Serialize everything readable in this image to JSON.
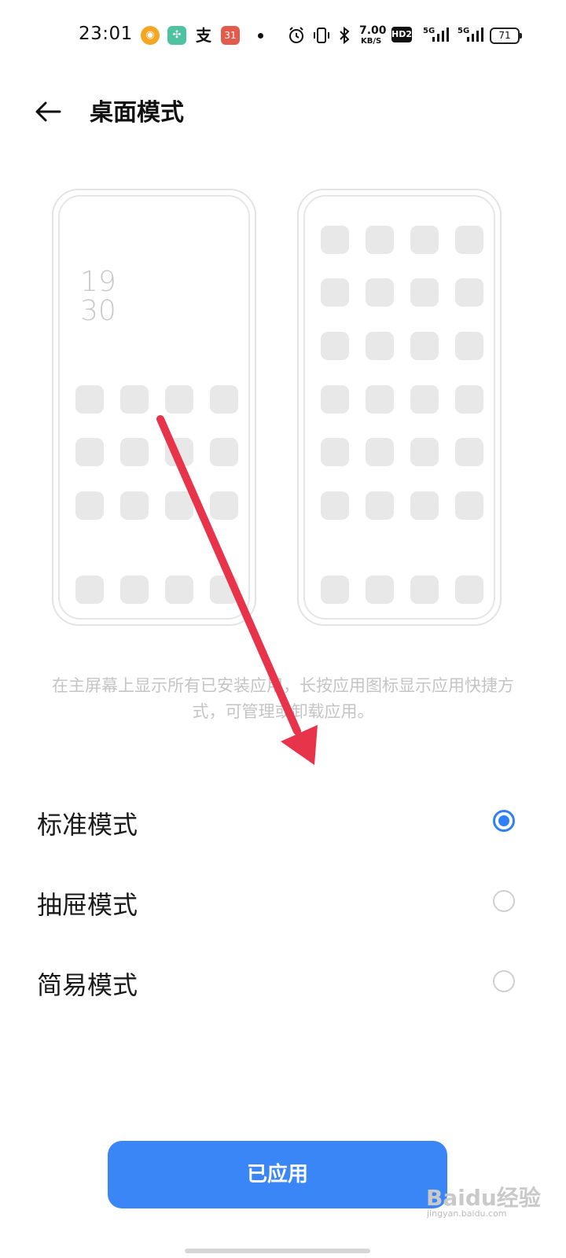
{
  "status_bar": {
    "time": "23:01",
    "calendar_badge": "31",
    "network_speed_value": "7.00",
    "network_speed_unit": "KB/S",
    "hd_label": "HD2",
    "sim1_label": "5G",
    "sim2_label": "5G",
    "battery": "71",
    "icons": [
      "weibo-icon",
      "wechat-mini-icon",
      "alipay-icon",
      "calendar-icon",
      "dot-icon",
      "alarm-icon",
      "vibrate-icon",
      "bluetooth-icon",
      "hd-icon",
      "signal-icon",
      "battery-icon"
    ]
  },
  "header": {
    "back_icon": "arrow-left-icon",
    "title": "桌面模式"
  },
  "preview": {
    "clock_hour": "19",
    "clock_minute": "30"
  },
  "description": "在主屏幕上显示所有已安装应用，长按应用图标显示应用快捷方式，可管理或卸载应用。",
  "options": [
    {
      "label": "标准模式",
      "selected": true
    },
    {
      "label": "抽屉模式",
      "selected": false
    },
    {
      "label": "简易模式",
      "selected": false
    }
  ],
  "apply_button": "已应用",
  "watermark": {
    "brand": "Baidu经验",
    "url": "jingyan.baidu.com"
  },
  "colors": {
    "accent": "#3a86f6",
    "annotation": "#e8344b"
  }
}
